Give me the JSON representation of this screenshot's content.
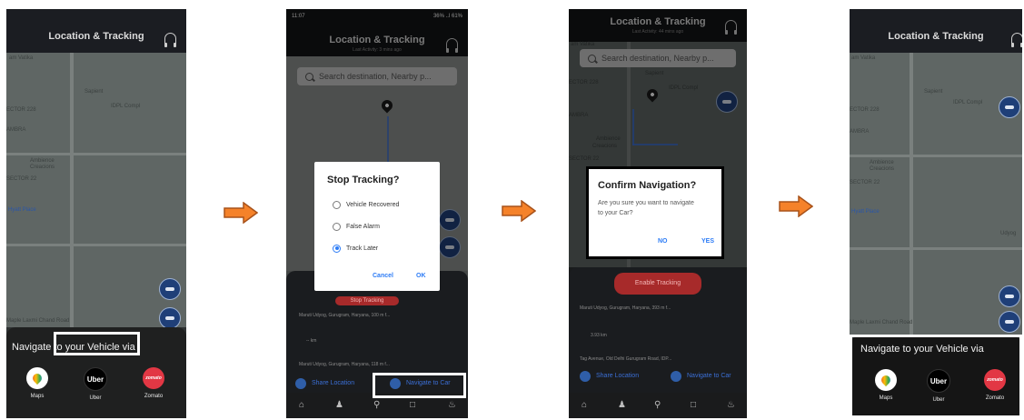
{
  "header": {
    "title": "Location & Tracking",
    "last_activity_2": "Last Activity: 3 mins ago",
    "last_activity_3": "Last Activity: 44 mins ago"
  },
  "status_bar": {
    "time": "11:07",
    "right": "36% ..l 61%"
  },
  "search": {
    "placeholder": "Search destination, Nearby p..."
  },
  "map_labels": {
    "vatika": "am Vatika",
    "sapient": "Sapient",
    "sector228": "ECTOR 228",
    "idpl": "IDPL Compl",
    "ambience": "Ambience",
    "creacions": "Creacions",
    "sector22": "SECTOR 22",
    "hyatt": "Hyatt Place",
    "udyog": "Udyog",
    "mapsl": "Maple Laxmi Chand Road",
    "lambra": "AMBRA"
  },
  "sheet": {
    "title": "Navigate to your Vehicle via"
  },
  "apps": [
    {
      "label": "Maps",
      "icon": "google-maps-icon"
    },
    {
      "label": "Uber",
      "icon": "uber-icon"
    },
    {
      "label": "Zomato",
      "icon": "zomato-icon"
    }
  ],
  "app_ico_text": {
    "uber": "Uber",
    "zomato": "zomato"
  },
  "stop_dialog": {
    "title": "Stop Tracking?",
    "options": [
      "Vehicle Recovered",
      "False Alarm",
      "Track Later"
    ],
    "selected": "Track Later",
    "cancel": "Cancel",
    "ok": "OK"
  },
  "panel2": {
    "stop_tracking_btn": "Stop Tracking",
    "addr1": "Maruti Udyog, Gurugram, Haryana, 100 m f...",
    "km": "-- km",
    "addr2": "Maruti Udyog, Gurugram, Haryana, 118 m f...",
    "share": "Share Location",
    "navigate": "Navigate to Car"
  },
  "confirm_dialog": {
    "title": "Confirm Navigation?",
    "body": "Are you sure you want to navigate to your Car?",
    "no": "NO",
    "yes": "YES"
  },
  "panel3": {
    "enable_tracking": "Enable Tracking",
    "addr1": "Maruti Udyog, Gurugram, Haryana, 393 m f...",
    "km": "3.93 km",
    "addr2": "Tag Avenue, Old Delhi Gurugram Road, IDP...",
    "share": "Share Location",
    "navigate": "Navigate to Car"
  },
  "colors": {
    "arrow": "#f5822a",
    "arrow_stroke": "#a8521a",
    "accent": "#2d7cf6",
    "map": "#5f6664"
  }
}
